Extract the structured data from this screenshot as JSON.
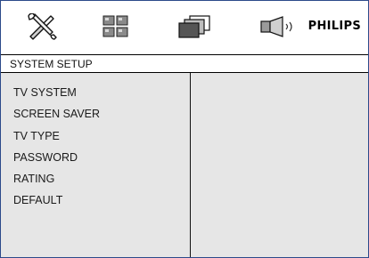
{
  "brand": "PHILIPS",
  "toolbar": {
    "icons": [
      {
        "name": "tools-icon"
      },
      {
        "name": "grid-icon"
      },
      {
        "name": "screens-icon"
      },
      {
        "name": "speaker-icon"
      }
    ]
  },
  "header": {
    "title": "SYSTEM SETUP"
  },
  "menu": {
    "items": [
      {
        "label": "TV SYSTEM"
      },
      {
        "label": "SCREEN SAVER"
      },
      {
        "label": "TV TYPE"
      },
      {
        "label": "PASSWORD"
      },
      {
        "label": "RATING"
      },
      {
        "label": "DEFAULT"
      }
    ]
  },
  "colors": {
    "panel": "#e6e6e6",
    "frame": "#2c4a8a"
  }
}
